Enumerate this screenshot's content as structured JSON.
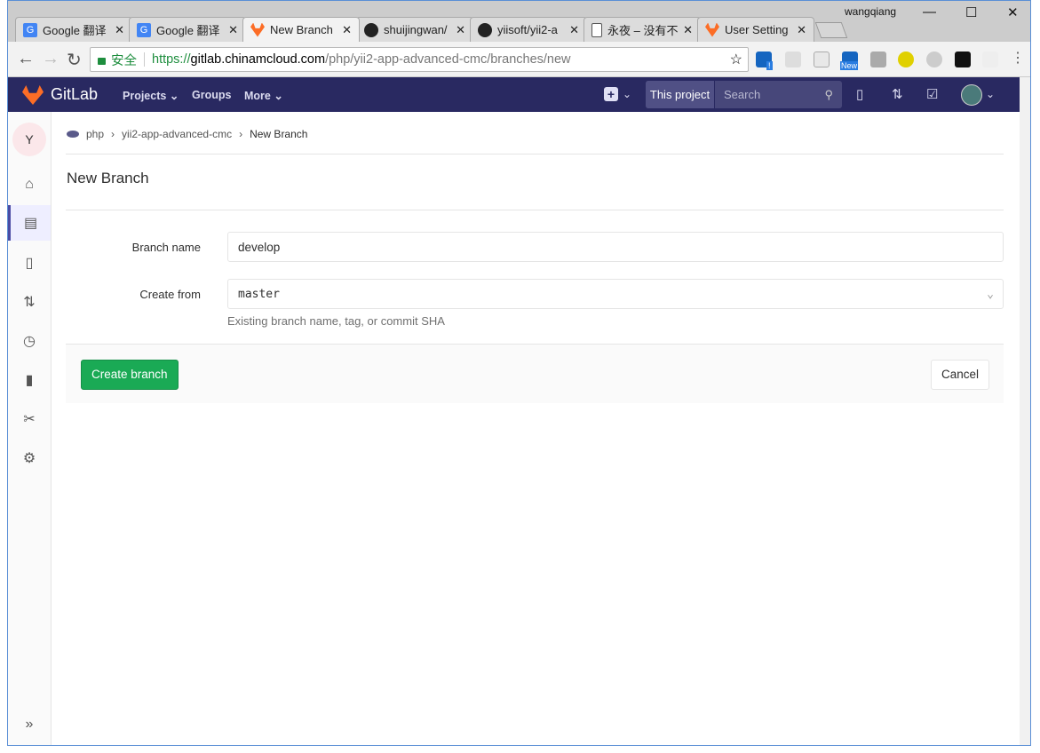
{
  "browser": {
    "user": "wangqiang",
    "tabs": [
      {
        "label": "Google 翻译",
        "icon": "google-translate-icon"
      },
      {
        "label": "Google 翻译",
        "icon": "google-translate-icon"
      },
      {
        "label": "New Branch",
        "icon": "gitlab-icon",
        "active": true
      },
      {
        "label": "shuijingwan/",
        "icon": "github-icon"
      },
      {
        "label": "yiisoft/yii2-a",
        "icon": "github-icon"
      },
      {
        "label": "永夜 – 没有不",
        "icon": "page-icon"
      },
      {
        "label": "User Setting",
        "icon": "gitlab-icon"
      }
    ],
    "secure_label": "安全",
    "url_scheme": "https://",
    "url_host": "gitlab.chinamcloud.com",
    "url_path": "/php/yii2-app-advanced-cmc/branches/new",
    "ext_badge_new": "New",
    "ext_badge_alert": "!"
  },
  "gitlab": {
    "brand": "GitLab",
    "nav": {
      "projects": "Projects",
      "groups": "Groups",
      "more": "More"
    },
    "search": {
      "scope": "This project",
      "placeholder": "Search"
    },
    "project_initial": "Y"
  },
  "breadcrumb": [
    "php",
    "yii2-app-advanced-cmc",
    "New Branch"
  ],
  "page": {
    "title": "New Branch",
    "branch_name_label": "Branch name",
    "branch_name_value": "develop",
    "create_from_label": "Create from",
    "create_from_value": "master",
    "help": "Existing branch name, tag, or commit SHA",
    "create_button": "Create branch",
    "cancel_button": "Cancel"
  },
  "colors": {
    "navbar": "#292961",
    "create": "#1aaa55"
  }
}
